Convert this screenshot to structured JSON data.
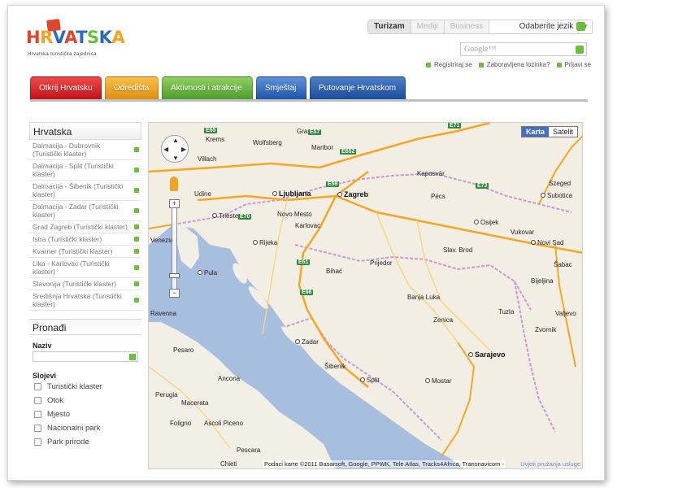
{
  "logo": {
    "wordmark": "HRVATSKA",
    "tagline": "Hrvatska turistička zajednica"
  },
  "topnav": {
    "tabs": [
      {
        "label": "Turizam",
        "active": true
      },
      {
        "label": "Mediji",
        "active": false
      },
      {
        "label": "Business",
        "active": false
      }
    ],
    "language_label": "Odaberite jezik"
  },
  "search": {
    "placeholder": "Google™"
  },
  "userlinks": [
    "Registriraj se",
    "Zaboravljena lozinka?",
    "Prijavi se"
  ],
  "main_tabs": [
    {
      "label": "Otkrij Hrvatsku",
      "color": "#d22027"
    },
    {
      "label": "Odredišta",
      "color": "#eea32a"
    },
    {
      "label": "Aktivnosti i atrakcije",
      "color": "#6ab443"
    },
    {
      "label": "Smještaj",
      "color": "#2f68bd"
    },
    {
      "label": "Putovanje Hrvatskom",
      "color": "#255aa8"
    }
  ],
  "left_panel": {
    "title": "Hrvatska",
    "regions": [
      "Dalmacija - Dubrovnik (Turistički klaster)",
      "Dalmacija - Split (Turistički klaster)",
      "Dalmacija - Šibenik (Turistički klaster)",
      "Dalmacija - Zadar (Turistički klaster)",
      "Grad Zagreb (Turistički klaster)",
      "Istra (Turistički klaster)",
      "Kvarner (Turistički klaster)",
      "Lika - Karlovac (Turistički klaster)",
      "Slavonija (Turistički klaster)",
      "Središnja Hrvatska (Turistički klaster)"
    ],
    "find_title": "Pronađi",
    "name_label": "Naziv",
    "layers_label": "Slojevi",
    "layers": [
      "Turistički klaster",
      "Otok",
      "Mjesto",
      "Nacionalni park",
      "Park prirode"
    ]
  },
  "map": {
    "types": [
      {
        "label": "Karta",
        "active": true
      },
      {
        "label": "Satelit",
        "active": false
      }
    ],
    "attribution": "Podaci karte ©2011 Basarsoft, Google, PPWK, Tele Atlas, Tracks4Africa, Transnavicom -",
    "terms": "Uvjeti pružanja usluge",
    "cities": {
      "zagreb": "Zagreb",
      "ljubljana": "Ljubljana",
      "sarajevo": "Sarajevo",
      "split": "Split",
      "zadar": "Zadar",
      "rijeka": "Rijeka",
      "pula": "Pula",
      "trieste": "Trieste",
      "osijek": "Osijek",
      "banja_luka": "Banja Luka",
      "mostar": "Mostar",
      "tuzla": "Tuzla",
      "novi_sad": "Novi Sad",
      "pecs": "Pécs",
      "subotica": "Subotica",
      "szeged": "Szeged",
      "kaposvar": "Kaposvár",
      "maribor": "Maribor",
      "graz": "Graz",
      "udine": "Udine",
      "venezia": "Venezia",
      "ravenna": "Ravenna",
      "pesaro": "Pesaro",
      "ancona": "Ancona",
      "perugia": "Perugia",
      "macerata": "Macerata",
      "ascoli": "Ascoli Piceno",
      "chieti": "Chieti",
      "pescara": "Pescara",
      "foligno": "Foligno",
      "bihac": "Bihać",
      "zenica": "Zenica",
      "prijedor": "Prijedor",
      "novi_mesto": "Novo Mesto",
      "karlovac": "Karlovac",
      "sibenik": "Šibenik",
      "wolfsberg": "Wolfsberg",
      "villach": "Villach",
      "krems": "Krems",
      "brod": "Slav. Brod",
      "vukovar": "Vukovar",
      "bijeljina": "Bijeljina",
      "zvornik": "Zvornik",
      "valjevo": "Valjevo",
      "sabac": "Šabac"
    },
    "roads": [
      "E65",
      "E57",
      "E59",
      "E71",
      "E70",
      "E73",
      "E652",
      "E61",
      "E66"
    ]
  }
}
